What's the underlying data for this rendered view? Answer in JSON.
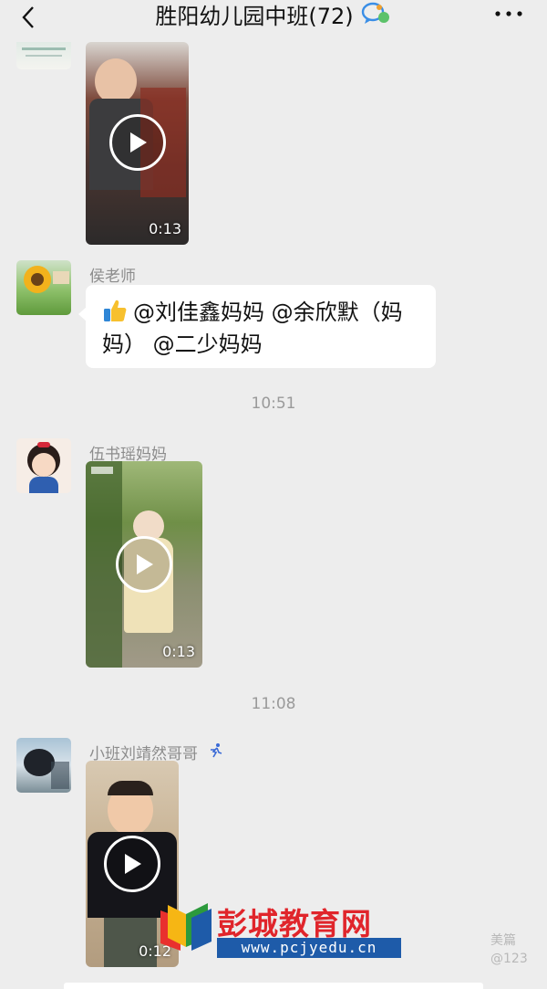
{
  "header": {
    "title": "胜阳幼儿园中班(72)"
  },
  "messages": [
    {
      "type": "video",
      "duration": "0:13"
    },
    {
      "type": "text",
      "sender": "侯老师",
      "text": "@刘佳鑫妈妈  @余欣默（妈妈） @二少妈妈"
    },
    {
      "type": "time",
      "text": "10:51"
    },
    {
      "type": "video",
      "sender": "伍书瑶妈妈",
      "duration": "0:13"
    },
    {
      "type": "time",
      "text": "11:08"
    },
    {
      "type": "video",
      "sender": "小班刘靖然哥哥",
      "duration": "0:12"
    }
  ],
  "watermark": {
    "site_name": "彭城教育网",
    "site_url": "www.pcjyedu.cn",
    "corner_label": "美篇",
    "corner_id": "@123"
  },
  "icons": {
    "back": "chevron-left-icon",
    "more": "more-dots-icon",
    "play": "play-icon",
    "thumbs_up": "thumbs-up-emoji"
  }
}
